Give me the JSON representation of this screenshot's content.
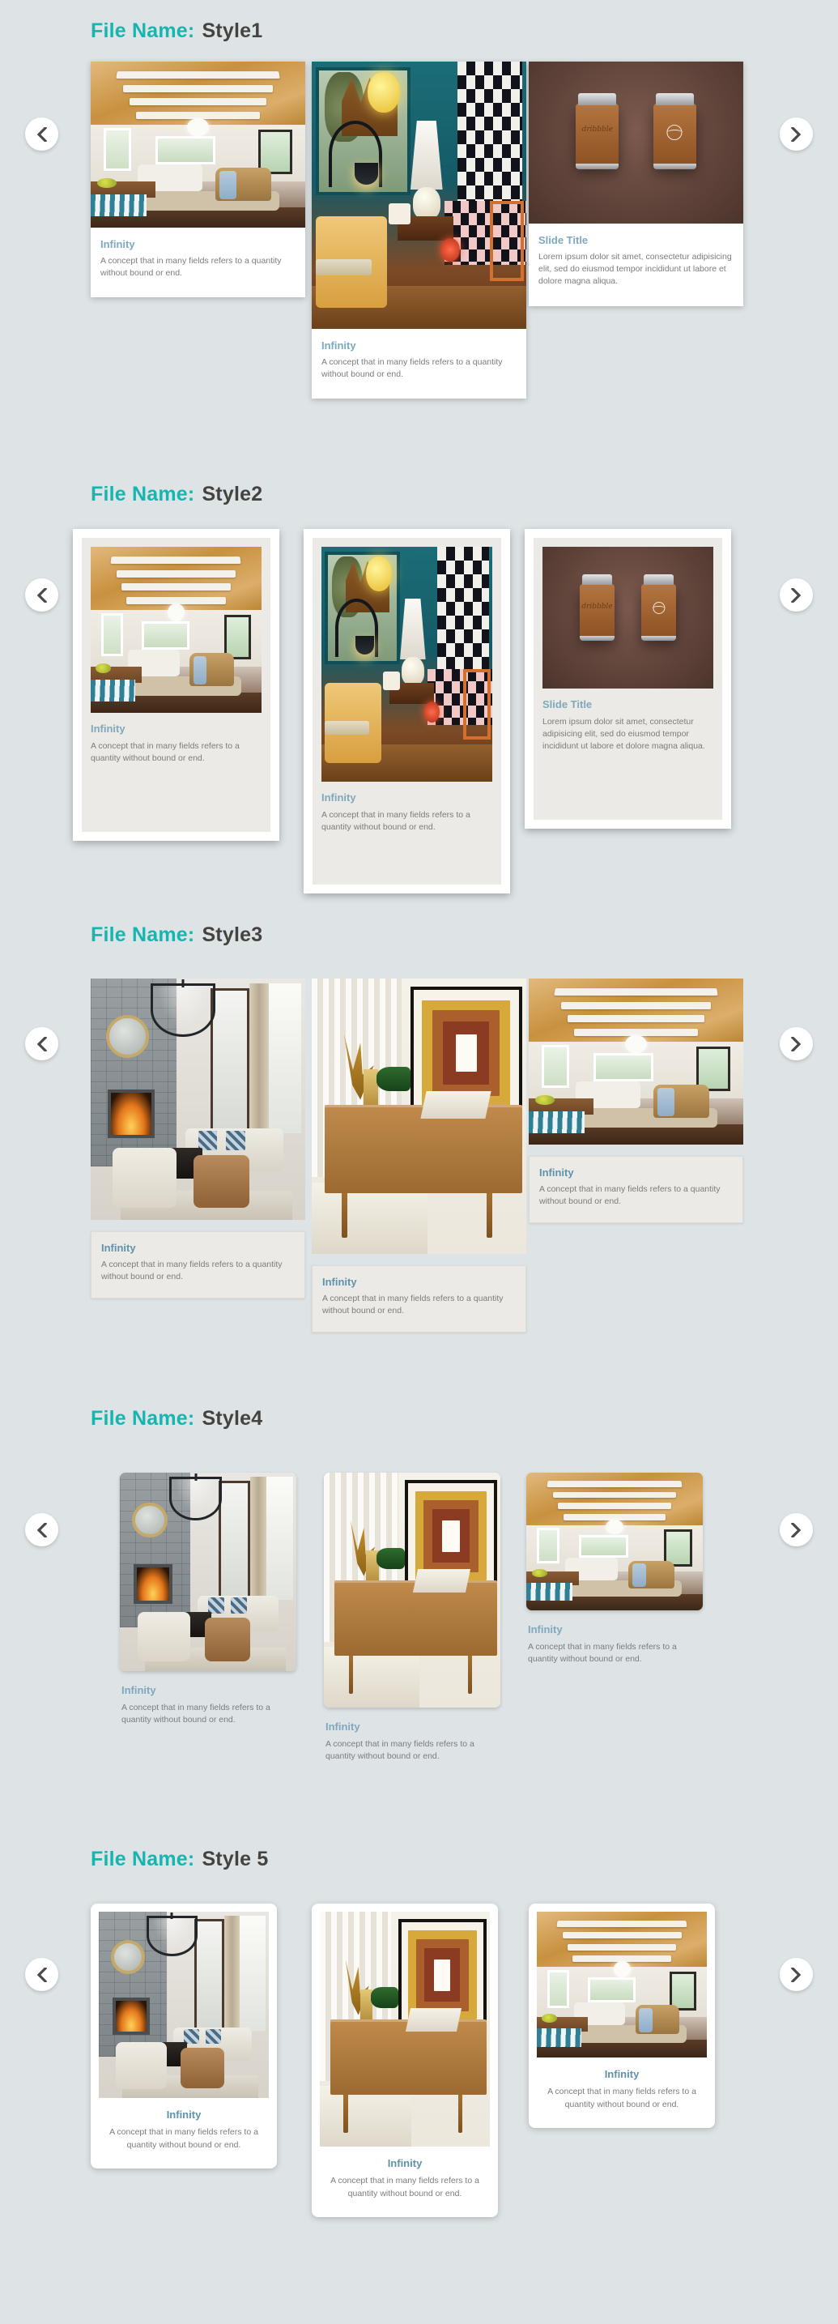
{
  "page": {
    "background_color": "#dee4e6",
    "accent_label_color": "#16b5b0",
    "value_color": "#44433f",
    "caption_title_color": "#7fa8bd",
    "caption_body_color": "#7c7c7c"
  },
  "nav": {
    "prev_label": "‹",
    "next_label": "›",
    "prev_icon": "chevron-left-icon",
    "next_icon": "chevron-right-icon"
  },
  "labels": {
    "file_name": "File Name:"
  },
  "captions": {
    "infinity_title": "Infinity",
    "infinity_body": "A concept that in many fields refers to a quantity without bound or end.",
    "slide_title": "Slide Title",
    "slide_body": "Lorem ipsum dolor sit amet, consectetur adipisicing elit, sed do eiusmod tempor incididunt ut labore et dolore magna aliqua."
  },
  "sections": [
    {
      "id": "style1",
      "name": "Style1",
      "cards": [
        {
          "image": "beamed-ceiling-sunroom",
          "title": "Infinity",
          "body": "A concept that in many fields refers to a quantity without bound or end."
        },
        {
          "image": "teal-shop-interior-lamp",
          "title": "Infinity",
          "body": "A concept that in many fields refers to a quantity without bound or end."
        },
        {
          "image": "brown-wall-two-lighters",
          "title": "Slide Title",
          "body": "Lorem ipsum dolor sit amet, consectetur adipisicing elit, sed do eiusmod tempor incididunt ut labore et dolore magna aliqua."
        }
      ]
    },
    {
      "id": "style2",
      "name": "Style2",
      "cards": [
        {
          "image": "beamed-ceiling-sunroom",
          "title": "Infinity",
          "body": "A concept that in many fields refers to a quantity without bound or end."
        },
        {
          "image": "teal-shop-interior-lamp",
          "title": "Infinity",
          "body": "A concept that in many fields refers to a quantity without bound or end."
        },
        {
          "image": "brown-wall-two-lighters",
          "title": "Slide Title",
          "body": "Lorem ipsum dolor sit amet, consectetur adipisicing elit, sed do eiusmod tempor incididunt ut labore et dolore magna aliqua."
        }
      ]
    },
    {
      "id": "style3",
      "name": "Style3",
      "cards": [
        {
          "image": "stone-fireplace-great-room",
          "title": "Infinity",
          "body": "A concept that in many fields refers to a quantity without bound or end."
        },
        {
          "image": "teak-credenza-artwork",
          "title": "Infinity",
          "body": "A concept that in many fields refers to a quantity without bound or end."
        },
        {
          "image": "beamed-ceiling-sunroom",
          "title": "Infinity",
          "body": "A concept that in many fields refers to a quantity without bound or end."
        }
      ]
    },
    {
      "id": "style4",
      "name": "Style4",
      "cards": [
        {
          "image": "stone-fireplace-great-room",
          "title": "Infinity",
          "body": "A concept that in many fields refers to a quantity without bound or end."
        },
        {
          "image": "teak-credenza-artwork",
          "title": "Infinity",
          "body": "A concept that in many fields refers to a quantity without bound or end."
        },
        {
          "image": "beamed-ceiling-sunroom",
          "title": "Infinity",
          "body": "A concept that in many fields refers to a quantity without bound or end."
        }
      ]
    },
    {
      "id": "style5",
      "name": "Style 5",
      "cards": [
        {
          "image": "stone-fireplace-great-room",
          "title": "Infinity",
          "body": "A concept that in many fields refers to a quantity without bound or end."
        },
        {
          "image": "teak-credenza-artwork",
          "title": "Infinity",
          "body": "A concept that in many fields refers to a quantity without bound or end."
        },
        {
          "image": "beamed-ceiling-sunroom",
          "title": "Infinity",
          "body": "A concept that in many fields refers to a quantity without bound or end."
        }
      ]
    }
  ]
}
